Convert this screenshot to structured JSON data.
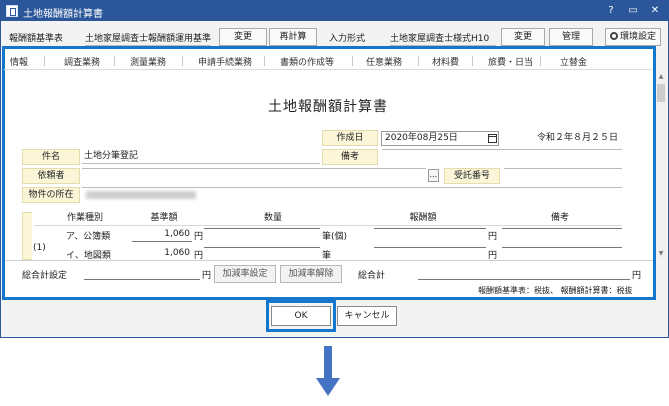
{
  "window": {
    "title": "土地報酬額計算書",
    "help": "?",
    "minimize": "▭",
    "close": "✕"
  },
  "header": {
    "base_label": "報酬額基準表",
    "base_value": "土地家屋調査士報酬額運用基準",
    "change_label": "変更",
    "recalc_label": "再計算",
    "input_format_label": "入力形式",
    "input_format_value": "土地家屋調査士様式H10",
    "change2_label": "変更",
    "manage_label": "管理",
    "settings_label": "環境設定"
  },
  "tabs": [
    {
      "label": "情報"
    },
    {
      "label": "調査業務"
    },
    {
      "label": "測量業務"
    },
    {
      "label": "申請手続業務"
    },
    {
      "label": "書類の作成等"
    },
    {
      "label": "任意業務"
    },
    {
      "label": "材料費"
    },
    {
      "label": "旅費・日当"
    },
    {
      "label": "立替金"
    }
  ],
  "document": {
    "title": "土地報酬額計算書",
    "created_label": "作成日",
    "created_date": "2020年08月25日",
    "created_wareki": "令和２年８月２５日",
    "case_label": "件名",
    "case_value": "土地分筆登記",
    "remarks_label": "備考",
    "client_label": "依頼者",
    "ellipsis": "...",
    "receipt_label": "受託番号",
    "location_label": "物件の所在"
  },
  "grid": {
    "headers": {
      "work_type": "作業種別",
      "base_amount": "基準額",
      "quantity": "数量",
      "fee": "報酬額",
      "remarks": "備考"
    },
    "group_label": "(1)",
    "rows": [
      {
        "name": "ア、公簿類",
        "amount": "1,060",
        "unit": "円",
        "qty_unit": "筆(個)",
        "fee_unit": "円"
      },
      {
        "name": "イ、地図類",
        "amount": "1,060",
        "unit": "円",
        "qty_unit": "筆",
        "fee_unit": "円"
      }
    ]
  },
  "footer": {
    "total_setting_label": "総合計設定",
    "yen": "円",
    "add_rate_set": "加減率設定",
    "add_rate_clear": "加減率解除",
    "total_label": "総合計",
    "total_yen": "円",
    "note": "報酬額基準表：税抜、 報酬額計算書：税抜"
  },
  "dialog": {
    "ok_label": "OK",
    "cancel_label": "キャンセル"
  },
  "colors": {
    "accent": "#1577cc",
    "title_bar": "#2b579a",
    "label_cell": "#fbf6d8",
    "arrow": "#4472c4"
  }
}
